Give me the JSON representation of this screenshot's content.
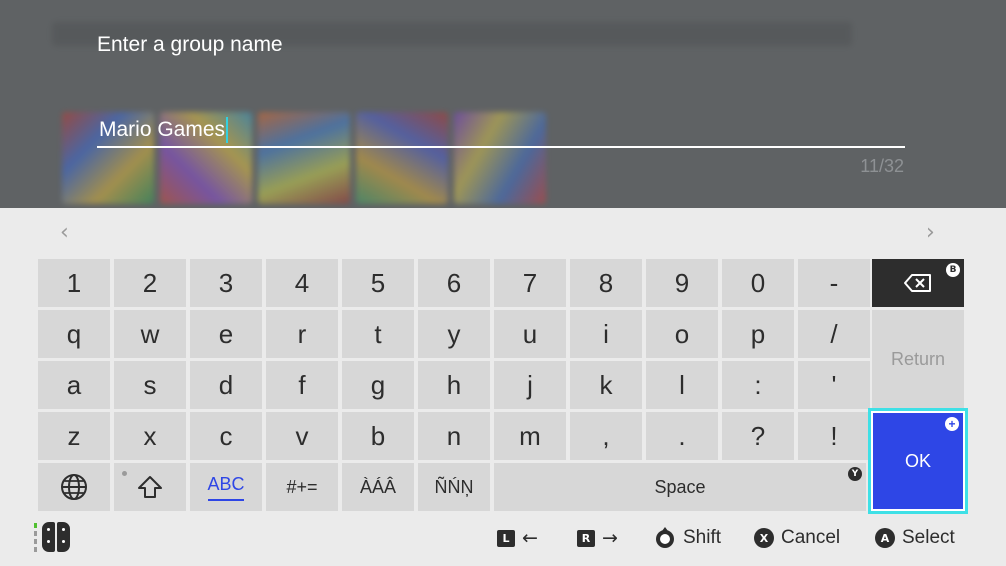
{
  "dialog": {
    "prompt": "Enter a group name",
    "value": "Mario Games",
    "counter": "11/32"
  },
  "keyboard": {
    "rows": [
      [
        "1",
        "2",
        "3",
        "4",
        "5",
        "6",
        "7",
        "8",
        "9",
        "0",
        "-"
      ],
      [
        "q",
        "w",
        "e",
        "r",
        "t",
        "y",
        "u",
        "i",
        "o",
        "p",
        "/"
      ],
      [
        "a",
        "s",
        "d",
        "f",
        "g",
        "h",
        "j",
        "k",
        "l",
        ":",
        "'"
      ],
      [
        "z",
        "x",
        "c",
        "v",
        "b",
        "n",
        "m",
        ",",
        ".",
        "?",
        "!"
      ]
    ],
    "backspace_badge": "B",
    "return_label": "Return",
    "ok_label": "OK",
    "bottom": {
      "abc_label": "ABC",
      "symbols_label": "#+=",
      "accents_a_label": "ÀÁÂ",
      "accents_n_label": "ÑŃŅ",
      "space_label": "Space",
      "space_badge": "Y"
    }
  },
  "footer": {
    "l_button": "L",
    "r_button": "R",
    "shift_label": "Shift",
    "cancel_button": "X",
    "cancel_label": "Cancel",
    "select_button": "A",
    "select_label": "Select"
  },
  "colors": {
    "ok_blue": "#2e46e6",
    "focus_cyan": "#3ee0e6",
    "key_gray": "#d7d7d7",
    "dark": "#2d2d2d"
  },
  "icons": [
    "nav-left-icon",
    "nav-right-icon",
    "backspace-icon",
    "globe-icon",
    "shift-icon",
    "joycon-icon",
    "stick-icon",
    "arrow-left-icon",
    "arrow-right-icon"
  ]
}
